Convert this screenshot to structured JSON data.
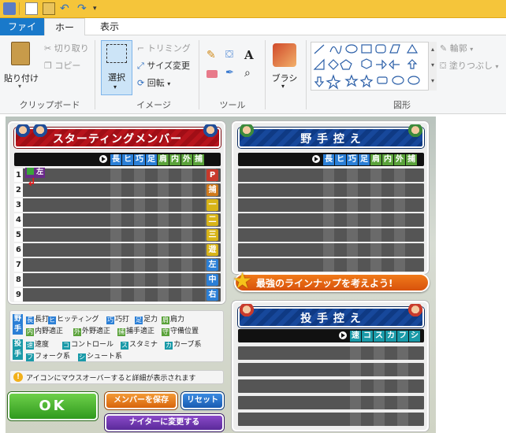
{
  "ribbon": {
    "tabs": [
      "ファイル",
      "ホーム",
      "表示"
    ],
    "clipboard": {
      "paste": "貼り付け",
      "cut": "切り取り",
      "copy": "コピー",
      "label": "クリップボード"
    },
    "image": {
      "select": "選択",
      "crop": "トリミング",
      "resize": "サイズ変更",
      "rotate": "回転",
      "label": "イメージ"
    },
    "tools": {
      "label": "ツール"
    },
    "brush": {
      "label": "ブラシ"
    },
    "shapes": {
      "outline": "輪郭",
      "fill": "塗りつぶし",
      "label": "図形"
    }
  },
  "game": {
    "starting": {
      "title": "スターティングメンバー",
      "abilities": [
        "長",
        "ヒ",
        "巧",
        "足",
        "肩",
        "内",
        "外",
        "捕"
      ],
      "first_batter_hand": "左",
      "rows": [
        {
          "num": "1",
          "pos": "P"
        },
        {
          "num": "2",
          "pos": "捕"
        },
        {
          "num": "3",
          "pos": "一"
        },
        {
          "num": "4",
          "pos": "二"
        },
        {
          "num": "5",
          "pos": "三"
        },
        {
          "num": "6",
          "pos": "遊"
        },
        {
          "num": "7",
          "pos": "左"
        },
        {
          "num": "8",
          "pos": "中"
        },
        {
          "num": "9",
          "pos": "右"
        }
      ],
      "pos_colors": [
        "#c83a2c",
        "#d07a1c",
        "#d8b418",
        "#d8b418",
        "#d8b418",
        "#d8b418",
        "#2b7fd6",
        "#2b7fd6",
        "#2b7fd6"
      ]
    },
    "fielders_bench": {
      "title": "野 手 控 え",
      "abilities": [
        "長",
        "ヒ",
        "巧",
        "足",
        "肩",
        "内",
        "外",
        "捕"
      ]
    },
    "pitchers_bench": {
      "title": "投 手 控 え",
      "abilities": [
        "速",
        "コ",
        "ス",
        "カ",
        "フ",
        "シ"
      ]
    },
    "promo": "最強のラインナップを考えよう!",
    "legend": {
      "fielder_label": "野手",
      "pitcher_label": "投手",
      "fielder_items": [
        {
          "k": "長",
          "t": "長打"
        },
        {
          "k": "ヒ",
          "t": "ヒッティング"
        },
        {
          "k": "巧",
          "t": "巧打"
        },
        {
          "k": "足",
          "t": "足力"
        },
        {
          "k": "肩",
          "t": "肩力"
        },
        {
          "k": "内",
          "t": "内野適正"
        },
        {
          "k": "外",
          "t": "外野適正"
        },
        {
          "k": "捕",
          "t": "捕手適正"
        },
        {
          "k": "守",
          "t": "守備位置"
        }
      ],
      "pitcher_items": [
        {
          "k": "速",
          "t": "速度"
        },
        {
          "k": "コ",
          "t": "コントロール"
        },
        {
          "k": "ス",
          "t": "スタミナ"
        },
        {
          "k": "カ",
          "t": "カーブ系"
        },
        {
          "k": "フ",
          "t": "フォーク系"
        },
        {
          "k": "シ",
          "t": "シュート系"
        }
      ]
    },
    "hint": "アイコンにマウスオーバーすると詳細が表示されます",
    "buttons": {
      "ok": "OK",
      "save": "メンバーを保存",
      "reset": "リセット",
      "night": "ナイターに変更する"
    }
  }
}
